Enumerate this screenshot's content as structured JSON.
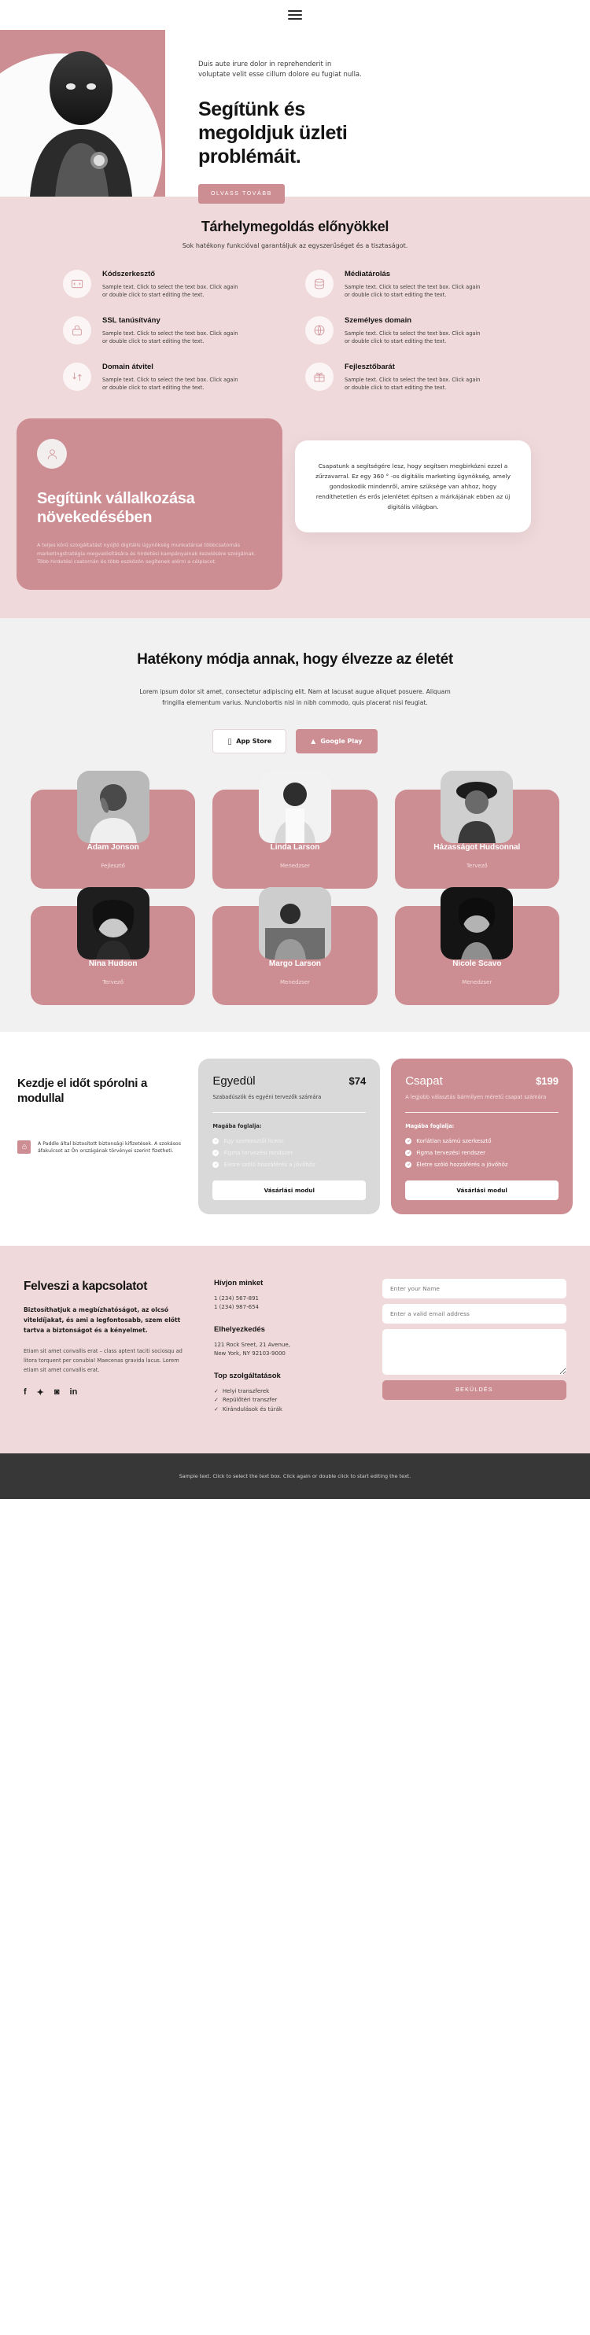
{
  "nav": {
    "menu_icon": "hamburger-menu-icon"
  },
  "hero": {
    "subtitle": "Duis aute irure dolor in reprehenderit in voluptate velit esse cillum dolore eu fugiat nulla.",
    "title": "Segítünk és megoldjuk üzleti problémáit.",
    "cta": "OLVASS TOVÁBB",
    "accent": "#cd8e93"
  },
  "features": {
    "heading": "Tárhelymegoldás előnyökkel",
    "lead": "Sok hatékony funkcióval garantáljuk az egyszerűséget és a tisztaságot.",
    "body": "Sample text. Click to select the text box. Click again or double click to start editing the text.",
    "items": [
      {
        "title": "Kódszerkesztő",
        "icon": "code-icon"
      },
      {
        "title": "Médiatárolás",
        "icon": "database-icon"
      },
      {
        "title": "SSL tanúsítvány",
        "icon": "lock-icon"
      },
      {
        "title": "Személyes domain",
        "icon": "globe-icon"
      },
      {
        "title": "Domain átvitel",
        "icon": "transfer-icon"
      },
      {
        "title": "Fejlesztőbarát",
        "icon": "gift-icon"
      }
    ]
  },
  "about": {
    "card_title": "Segítünk vállalkozása növekedésében",
    "card_text": "A teljes körű szolgáltatást nyújtó digitális ügynökség munkatársai többcsatornás marketingstratégia megvalósítására és hirdetési kampányainak kezelésére szolgálnak. Több hirdetési csatornán és több eszközön segítenek elérni a célpiacot.",
    "quote": "Csapatunk a segítségére lesz, hogy segítsen megbirkózni ezzel a zűrzavarral. Ez egy 360 ° -os digitális marketing ügynökség, amely gondoskodik mindenről, amire szüksége van ahhoz, hogy rendíthetetlen és erős jelenlétet építsen a márkájának ebben az új digitális világban."
  },
  "app": {
    "heading": "Hatékony módja annak, hogy élvezze az életét",
    "text": "Lorem ipsum dolor sit amet, consectetur adipiscing elit. Nam at lacusat augue aliquet posuere. Aliquam fringilla elementum varius. Nunclobortis nisl in nibh commodo, quis placerat nisi feugiat.",
    "appstore": "App Store",
    "googleplay": "Google Play"
  },
  "team": {
    "members": [
      {
        "name": "Adam Jonson",
        "role": "Fejlesztő"
      },
      {
        "name": "Linda Larson",
        "role": "Menedzser"
      },
      {
        "name": "Házasságot Hudsonnal",
        "role": "Tervező"
      },
      {
        "name": "Nina Hudson",
        "role": "Tervező"
      },
      {
        "name": "Margo Larson",
        "role": "Menedzser"
      },
      {
        "name": "Nicole Scavo",
        "role": "Menedzser"
      }
    ]
  },
  "pricing": {
    "heading": "Kezdje el időt spórolni a modullal",
    "note": "A Paddle által biztosított biztonsági kifizetések. A szokásos áfakulcsot az Ön országának törvényei szerint fizetheti.",
    "note_icon": "lock-icon",
    "plans": [
      {
        "name": "Egyedül",
        "price": "$74",
        "desc": "Szabadúszók és egyéni tervezők számára",
        "includes_label": "Magába foglalja:",
        "features": [
          "Egy szerkesztői licenc",
          "Figma tervezési rendszer",
          "Életre szóló hozzáférés a jövőhöz"
        ],
        "button": "Vásárlási modul",
        "theme": "grey"
      },
      {
        "name": "Csapat",
        "price": "$199",
        "desc": "A legjobb választás bármilyen méretű csapat számára",
        "includes_label": "Magába foglalja:",
        "features": [
          "Korlátlan számú szerkesztő",
          "Figma tervezési rendszer",
          "Életre szóló hozzáférés a jövőhöz"
        ],
        "button": "Vásárlási modul",
        "theme": "pink"
      }
    ]
  },
  "contact": {
    "heading": "Felveszi a kapcsolatot",
    "lead": "Biztosíthatjuk a megbízhatóságot, az olcsó viteldíjakat, és ami a legfontosabb, szem előtt tartva a biztonságot és a kényelmet.",
    "body": "Etiam sit amet convallis erat – class aptent taciti sociosqu ad litora torquent per conubia! Maecenas gravida lacus. Lorem etiam sit amet convallis erat.",
    "social": [
      {
        "name": "facebook-icon",
        "glyph": "f"
      },
      {
        "name": "twitter-icon",
        "glyph": "✦"
      },
      {
        "name": "instagram-icon",
        "glyph": "◙"
      },
      {
        "name": "linkedin-icon",
        "glyph": "in"
      }
    ],
    "call_title": "Hívjon minket",
    "phone1": "1 (234) 567-891",
    "phone2": "1 (234) 987-654",
    "location_title": "Elhelyezkedés",
    "address1": "121 Rock Sreet, 21 Avenue,",
    "address2": "New York, NY 92103-9000",
    "services_title": "Top szolgáltatások",
    "services": [
      "Helyi transzferek",
      "Repülőtéri transzfer",
      "Kirándulások és túrák"
    ],
    "form": {
      "name_placeholder": "Enter your Name",
      "email_placeholder": "Enter a valid email address",
      "message_placeholder": "",
      "submit": "BEKÜLDÉS"
    }
  },
  "footer": {
    "text": "Sample text. Click to select the text box. Click again or double click to start editing the text."
  }
}
